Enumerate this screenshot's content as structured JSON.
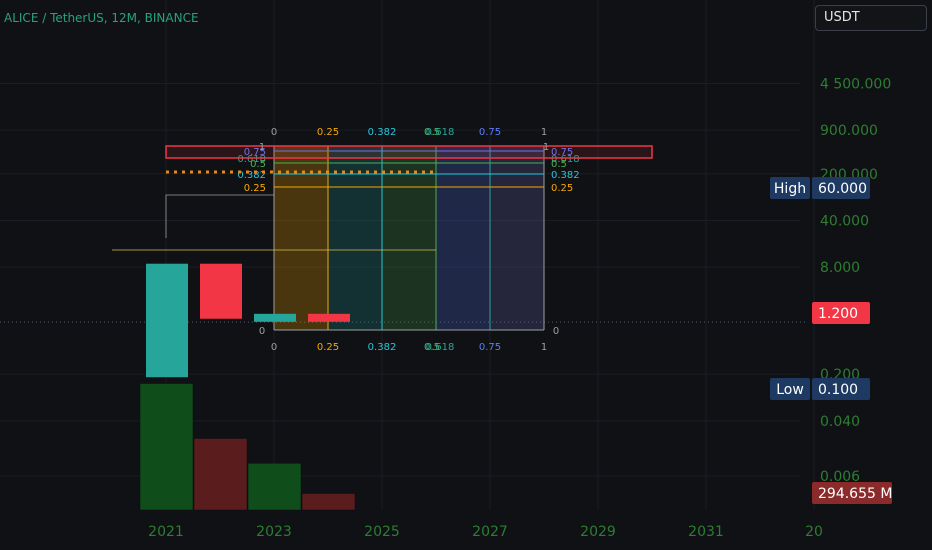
{
  "header": {
    "title": "ALICE / TetherUS, 12M, BINANCE",
    "currency": "USDT"
  },
  "colors": {
    "up": "#26a69a",
    "down": "#f23645",
    "volume_up": "#0f4d1a",
    "volume_down": "#5a1c1c",
    "axis_text": "#2e7d32",
    "tag_blue": "#1e3a63",
    "tag_red": "#c43a3a"
  },
  "chart_data": {
    "type": "candlestick",
    "yscale": "log",
    "ylim": [
      0.0052,
      12000
    ],
    "y_ticks": [
      {
        "value": 4500,
        "label": "4 500.000"
      },
      {
        "value": 900,
        "label": "900.000"
      },
      {
        "value": 200,
        "label": "200.000"
      },
      {
        "value": 40,
        "label": "40.000"
      },
      {
        "value": 8,
        "label": "8.000"
      },
      {
        "value": 0.2,
        "label": "0.200"
      },
      {
        "value": 0.04,
        "label": "0.040"
      },
      {
        "value": 0.006,
        "label": "0.006"
      }
    ],
    "x_ticks": [
      "2021",
      "2023",
      "2025",
      "2027",
      "2029",
      "2031",
      "20"
    ],
    "candles": [
      {
        "year": 2021,
        "open": 0.18,
        "close": 9.0,
        "high": 40,
        "low": 0.16,
        "direction": "up"
      },
      {
        "year": 2022,
        "open": 9.0,
        "close": 1.35,
        "high": 9.0,
        "low": 1.35,
        "direction": "down"
      },
      {
        "year": 2023,
        "open": 1.35,
        "close": 1.6,
        "high": 1.6,
        "low": 1.35,
        "direction": "up"
      },
      {
        "year": 2024,
        "open": 1.6,
        "close": 1.35,
        "high": 1.6,
        "low": 1.35,
        "direction": "down"
      }
    ],
    "volume": [
      {
        "year": 2021,
        "level": 0.46,
        "direction": "up"
      },
      {
        "year": 2022,
        "level": 0.26,
        "direction": "down"
      },
      {
        "year": 2023,
        "level": 0.17,
        "direction": "up"
      },
      {
        "year": 2024,
        "level": 0.06,
        "direction": "down"
      }
    ],
    "fib_levels_top": [
      "0",
      "0.25",
      "0.382",
      "0.5",
      "0.618",
      "0.75",
      "1"
    ],
    "fib_levels_side": [
      "0.75",
      "0.618",
      "0.5",
      "0.382",
      "0.25"
    ],
    "fib_zero": "0",
    "fib_one": "1",
    "price_tags": [
      {
        "name": "High",
        "value": "60.000",
        "style": "blue"
      },
      {
        "name": "",
        "value": "1.200",
        "style": "red"
      },
      {
        "name": "Low",
        "value": "0.100",
        "style": "blue"
      },
      {
        "name": "",
        "value": "294.655 M",
        "style": "darkred"
      }
    ]
  }
}
